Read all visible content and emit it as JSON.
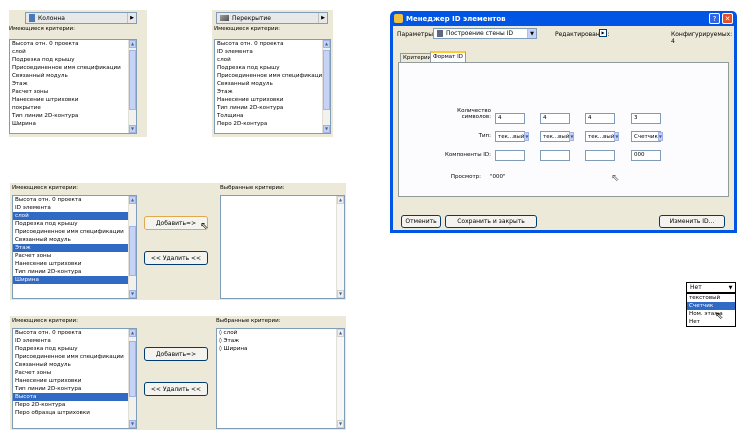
{
  "panel1": {
    "combo": "Колонна",
    "label": "Имеющиеся критерии:",
    "items": [
      "Высота отн. 0 проекта",
      "слой",
      "Подрезка под крышу",
      "Присоединенное имя спецификации",
      "Связанный модуль",
      "Этаж",
      "Расчет зоны",
      "Нанесение штриховки",
      "покрытие",
      "Тип линии 2D-контура",
      "Ширина"
    ]
  },
  "panel2": {
    "combo": "Перекрытие",
    "label": "Имеющиеся критерии:",
    "items": [
      "Высота отн. 0 проекта",
      "ID элемента",
      "слой",
      "Подрезка под крышу",
      "Присоединенное имя спецификации",
      "Связанный модуль",
      "Этаж",
      "Нанесение штриховки",
      "Тип линии 2D-контура",
      "Толщина",
      "Перо 2D-контура"
    ]
  },
  "panel3": {
    "available_label": "Имеющиеся критерии:",
    "selected_label": "Выбранные критерии:",
    "items": [
      "Высота отн. 0 проекта",
      "ID элемента",
      "слой",
      "Подрезка под крышу",
      "Присоединенное имя спецификации",
      "Связанный модуль",
      "Этаж",
      "Расчет зоны",
      "Нанесение штриховки",
      "Тип линии 2D-контура",
      "Ширина"
    ],
    "add_button": "Добавить=>",
    "remove_button": "<< Удалить <<",
    "selected_items": []
  },
  "panel4": {
    "available_label": "Имеющиеся критерии:",
    "selected_label": "Выбранные критерии:",
    "items": [
      "Высота отн. 0 проекта",
      "ID элемента",
      "Подрезка под крышу",
      "Присоединенное имя спецификации",
      "Связанный модуль",
      "Расчет зоны",
      "Нанесение штриховки",
      "Тип линии 2D-контура",
      "Высота",
      "Перо 2D-контура",
      "Перо образца штриховки"
    ],
    "add_button": "Добавить=>",
    "remove_button": "<< Удалить <<",
    "selected_items": [
      "◊ слой",
      "◊ Этаж",
      "◊ Ширина"
    ]
  },
  "dialog": {
    "title": "Менеджер ID элементов",
    "params_label": "Параметры:",
    "params_value": "Построение стены ID",
    "edit_label": "Редактирование:",
    "config_label": "Конфигурируемых: 4",
    "tabs": [
      "Критерии",
      "Формат ID"
    ],
    "count_label": "Количество символов:",
    "type_label": "Тип:",
    "components_label": "Компоненты ID:",
    "preview_label": "Просмотр:",
    "preview_value": "\"000\"",
    "counts": [
      "4",
      "4",
      "4",
      "3"
    ],
    "types": [
      "тек...вый",
      "тек...вый",
      "тек...вый",
      "Счетчик"
    ],
    "components": [
      "",
      "",
      "",
      "000"
    ],
    "cancel": "Отменить",
    "save_close": "Сохранить и закрыть",
    "change_id": "Изменить ID..."
  },
  "dropdown": {
    "value": "Нет",
    "options": [
      "текстовый",
      "Счетчик",
      "Ном. этажа",
      "Нет"
    ]
  }
}
